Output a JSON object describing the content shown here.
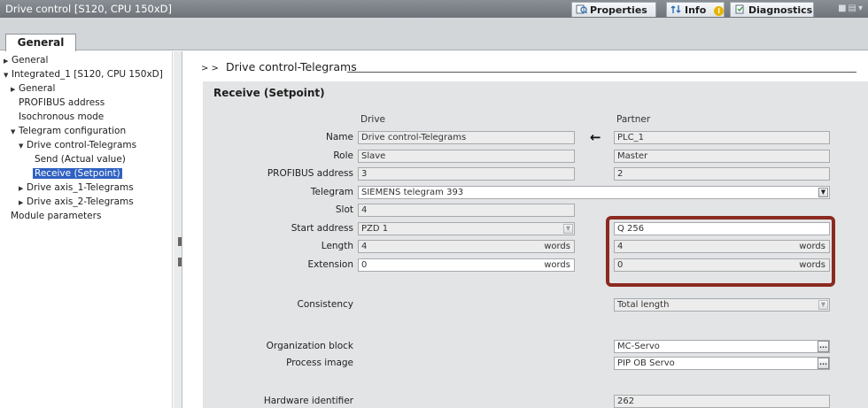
{
  "window": {
    "title": "Drive control [S120, CPU 150xD]",
    "tabs": [
      {
        "label": "Properties",
        "icon": "properties-icon"
      },
      {
        "label": "Info",
        "icon": "info-icon"
      },
      {
        "label": "Diagnostics",
        "icon": "diagnostics-icon"
      }
    ]
  },
  "main_tab": "General",
  "tree": [
    "General",
    "Integrated_1 [S120, CPU 150xD]",
    "General",
    "PROFIBUS address",
    "Isochronous mode",
    "Telegram configuration",
    "Drive control-Telegrams",
    "Send (Actual value)",
    "Receive (Setpoint)",
    "Drive axis_1-Telegrams",
    "Drive axis_2-Telegrams",
    "Module parameters"
  ],
  "breadcrumb": {
    "arrows": "> >",
    "text": "Drive control-Telegrams"
  },
  "section_title": "Receive (Setpoint)",
  "columns": {
    "drive": "Drive",
    "partner": "Partner"
  },
  "labels": {
    "name": "Name",
    "role": "Role",
    "profibus": "PROFIBUS address",
    "telegram": "Telegram",
    "slot": "Slot",
    "start_address": "Start address",
    "length": "Length",
    "extension": "Extension",
    "consistency": "Consistency",
    "org_block": "Organization block",
    "process_image": "Process image",
    "hw_id": "Hardware identifier"
  },
  "drive": {
    "name": "Drive control-Telegrams",
    "role": "Slave",
    "profibus": "3",
    "telegram": "SIEMENS telegram 393",
    "slot": "4",
    "start_address": "PZD 1",
    "length": "4",
    "extension": "0"
  },
  "partner": {
    "name": "PLC_1",
    "role": "Master",
    "profibus": "2",
    "start_address": "Q 256",
    "length": "4",
    "extension": "0",
    "consistency": "Total length",
    "org_block": "MC-Servo",
    "process_image": "PIP OB Servo",
    "hw_id": "262"
  },
  "units": {
    "words": "words"
  },
  "colors": {
    "highlight": "#8b2a20",
    "selection": "#2f61c1"
  }
}
